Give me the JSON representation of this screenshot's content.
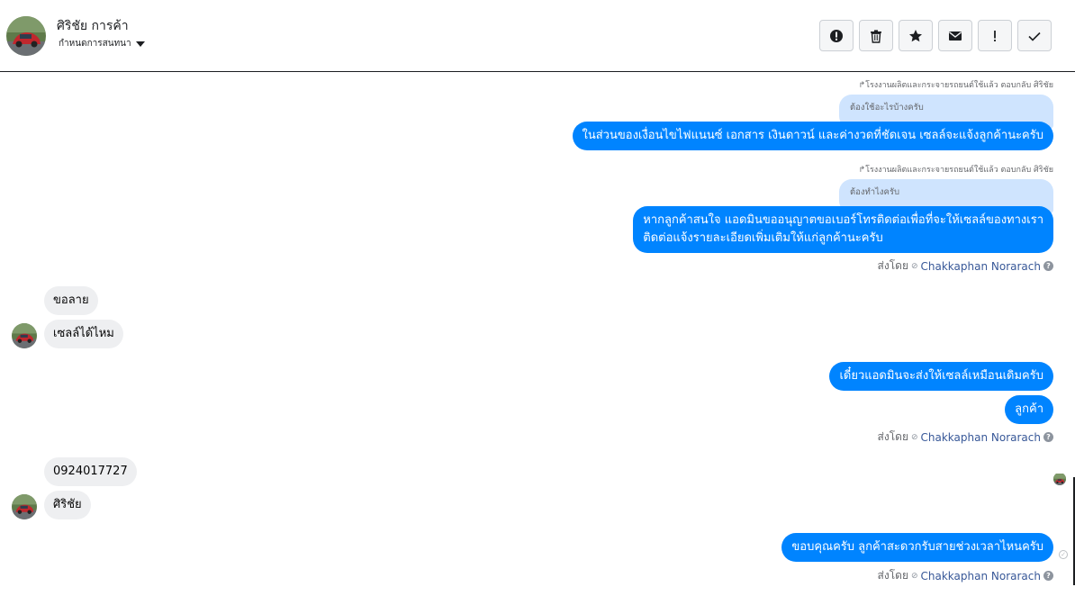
{
  "header": {
    "contact_name": "ศิริชัย การค้า",
    "assign_label": "กำหนดการสนทนา",
    "toolbar": {
      "alert": "alert-circle-icon",
      "delete": "trash-icon",
      "star": "star-icon",
      "email": "envelope-icon",
      "important": "exclamation-icon",
      "done": "checkmark-icon"
    }
  },
  "thread": {
    "reply1": {
      "meta": "โรงงานผลิตและกระจายรถยนต์ใช้แล้ว ตอบกลับ ศิริชัย",
      "quote": "ต้องใช้อะไรบ้างครับ",
      "text": "ในส่วนของเงื่อนไขไฟแนนซ์ เอกสาร เงินดาวน์ และค่างวดที่ชัดเจน เซลล์จะแจ้งลูกค้านะครับ"
    },
    "reply2": {
      "meta": "โรงงานผลิตและกระจายรถยนต์ใช้แล้ว ตอบกลับ ศิริชัย",
      "quote": "ต้องทำไงครับ",
      "line1": "หากลูกค้าสนใจ แอดมินขออนุญาตขอเบอร์โทรติดต่อเพื่อที่จะให้เซลล์ของทางเรา",
      "line2": "ติดต่อแจ้งรายละเอียดเพิ่มเติมให้แก่ลูกค้านะครับ"
    },
    "sent_by_label": "ส่งโดย",
    "agent_name": "Chakkaphan Norarach",
    "incoming1": [
      "ขอลาย",
      "เซลล์ได้ไหม"
    ],
    "outgoing1": [
      "เดี๋ยวแอดมินจะส่งให้เซลล์เหมือนเดิมครับ",
      "ลูกค้า"
    ],
    "incoming2": [
      "0924017727",
      "ศิริชัย"
    ],
    "outgoing2": [
      "ขอบคุณครับ ลูกค้าสะดวกรับสายช่วงเวลาไหนครับ"
    ],
    "colors": {
      "outgoing": "#0084ff",
      "incoming": "#eeeff1",
      "quote": "#cfe4fe",
      "agent": "#385898"
    }
  }
}
